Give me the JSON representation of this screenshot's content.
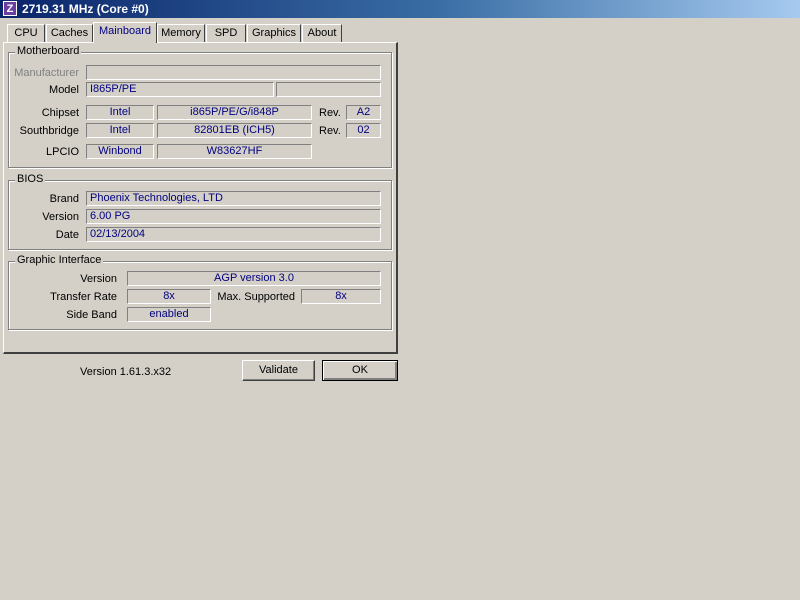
{
  "window": {
    "title": "2719.31 MHz (Core #0)",
    "icon_letter": "Z"
  },
  "tabs": [
    {
      "label": "CPU"
    },
    {
      "label": "Caches"
    },
    {
      "label": "Mainboard",
      "active": true
    },
    {
      "label": "Memory"
    },
    {
      "label": "SPD"
    },
    {
      "label": "Graphics"
    },
    {
      "label": "About"
    }
  ],
  "motherboard": {
    "title": "Motherboard",
    "manufacturer_label": "Manufacturer",
    "manufacturer_value": "",
    "model_label": "Model",
    "model_value": "I865P/PE",
    "model_extra": "",
    "chipset_label": "Chipset",
    "chipset_vendor": "Intel",
    "chipset_model": "i865P/PE/G/i848P",
    "chipset_rev_label": "Rev.",
    "chipset_rev": "A2",
    "southbridge_label": "Southbridge",
    "southbridge_vendor": "Intel",
    "southbridge_model": "82801EB (ICH5)",
    "southbridge_rev_label": "Rev.",
    "southbridge_rev": "02",
    "lpcio_label": "LPCIO",
    "lpcio_vendor": "Winbond",
    "lpcio_model": "W83627HF"
  },
  "bios": {
    "title": "BIOS",
    "brand_label": "Brand",
    "brand_value": "Phoenix Technologies, LTD",
    "version_label": "Version",
    "version_value": "6.00 PG",
    "date_label": "Date",
    "date_value": "02/13/2004"
  },
  "graphic_interface": {
    "title": "Graphic Interface",
    "version_label": "Version",
    "version_value": "AGP version 3.0",
    "transfer_rate_label": "Transfer Rate",
    "transfer_rate_value": "8x",
    "max_supported_label": "Max. Supported",
    "max_supported_value": "8x",
    "side_band_label": "Side Band",
    "side_band_value": "enabled"
  },
  "footer": {
    "version_text": "Version 1.61.3.x32",
    "validate_label": "Validate",
    "ok_label": "OK"
  }
}
